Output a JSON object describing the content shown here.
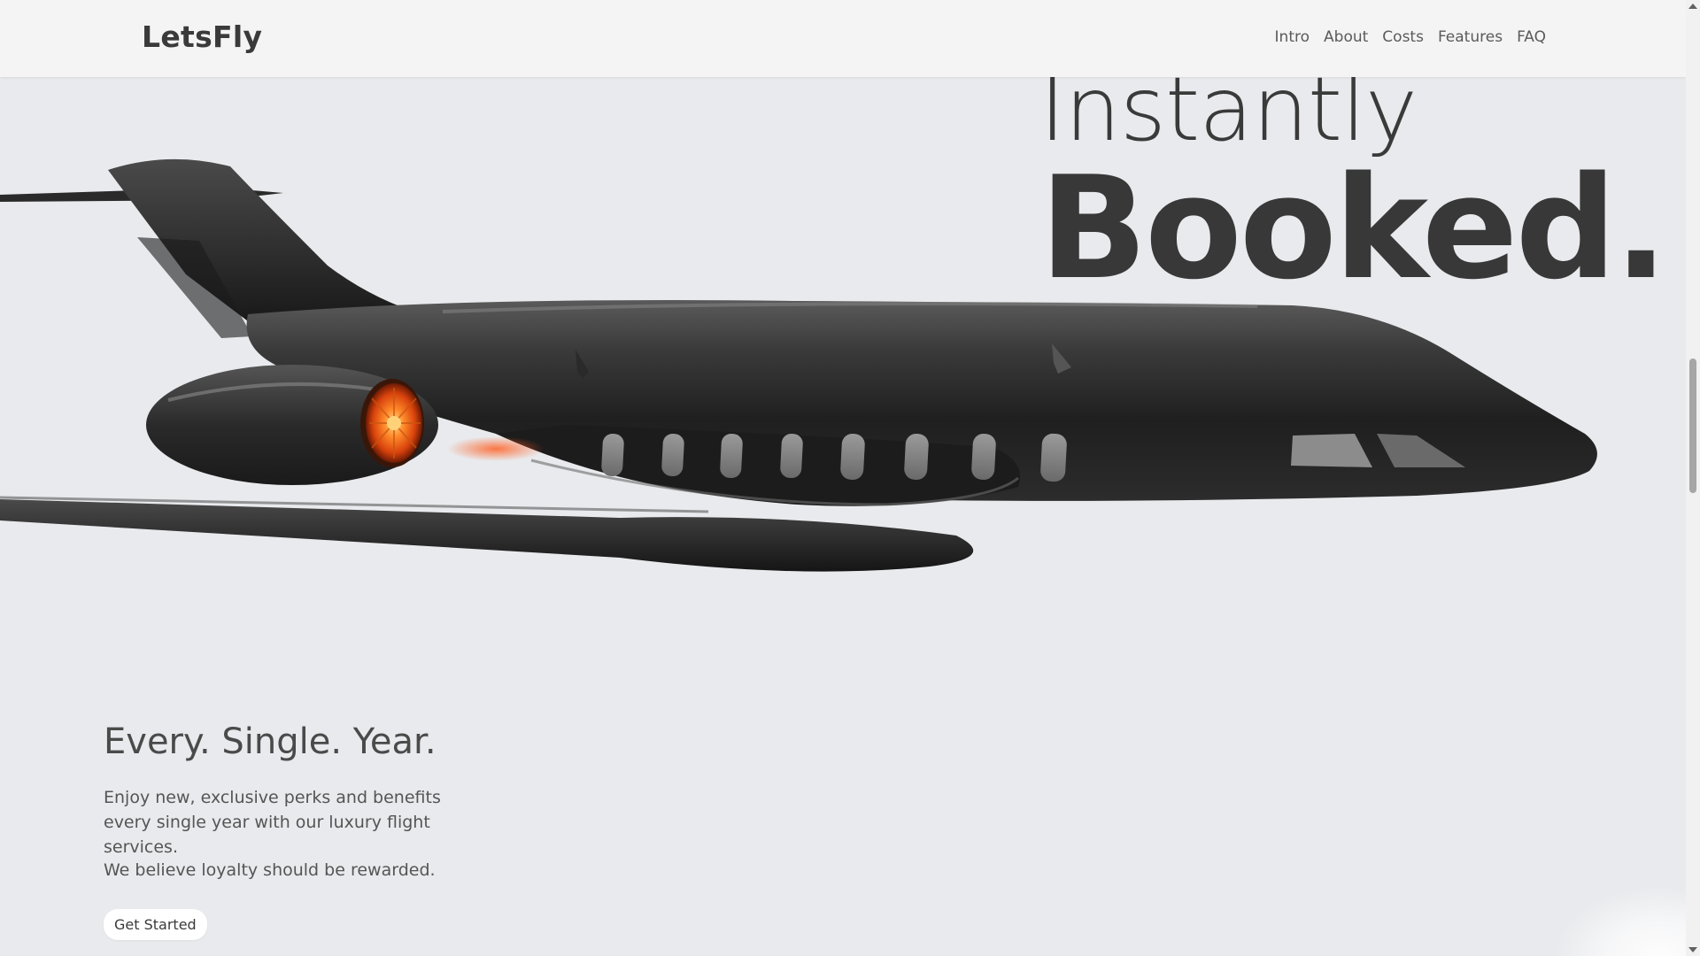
{
  "brand": "LetsFly",
  "nav": {
    "items": [
      "Intro",
      "About",
      "Costs",
      "Features",
      "FAQ"
    ]
  },
  "hero": {
    "line1": "Instantly",
    "line2": "Booked."
  },
  "section": {
    "title": "Every. Single. Year.",
    "text": "Enjoy new, exclusive perks and benefits every single year with our luxury flight services.",
    "text2": "We believe loyalty should be rewarded.",
    "cta_label": "Get Started"
  },
  "colors": {
    "background": "#e9eaed",
    "header": "#f4f4f4",
    "text_dark": "#383838",
    "engine_glow": "#ff6a1a"
  },
  "images": {
    "plane": "black-private-jet-image",
    "window_count": 8
  }
}
